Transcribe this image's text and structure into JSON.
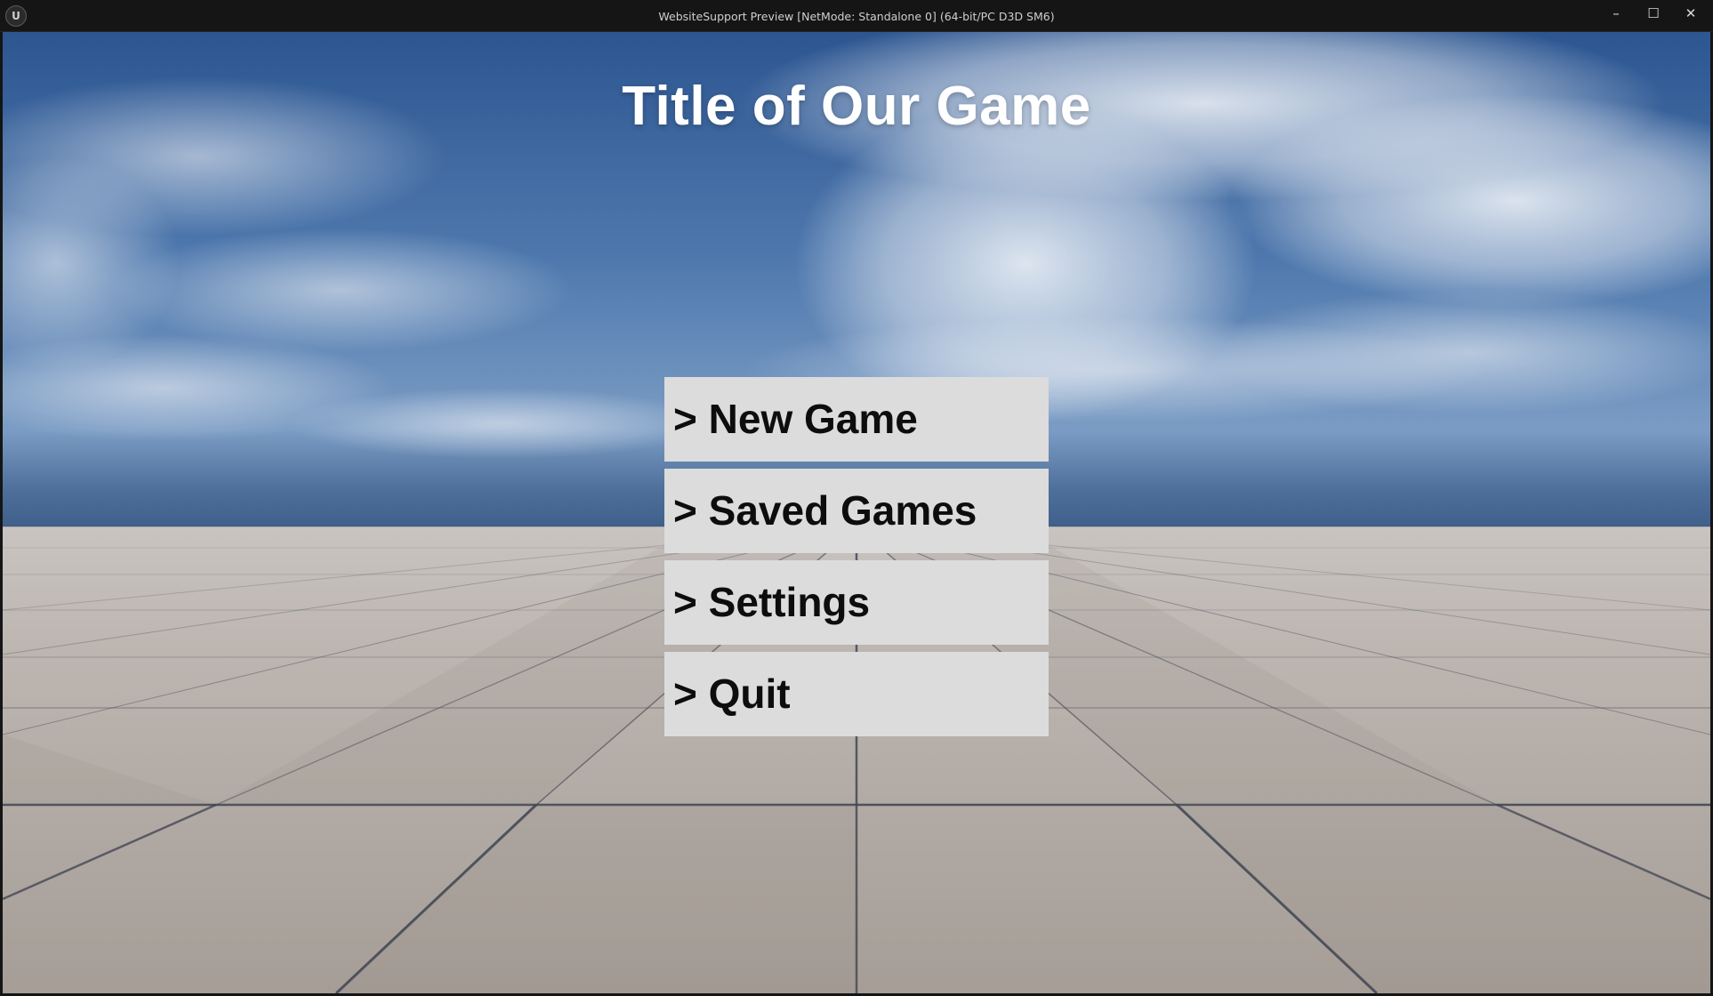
{
  "window": {
    "title": "WebsiteSupport Preview [NetMode: Standalone 0]  (64-bit/PC D3D SM6)",
    "icon": "unreal-engine-icon",
    "controls": {
      "minimize": "–",
      "maximize": "☐",
      "close": "✕"
    }
  },
  "game": {
    "title": "Title of Our Game"
  },
  "menu": {
    "items": [
      {
        "label": "> New Game"
      },
      {
        "label": "> Saved Games"
      },
      {
        "label": "> Settings"
      },
      {
        "label": "> Quit"
      }
    ]
  },
  "colors": {
    "sky_top": "#2d5691",
    "sky_horizon": "#7b9cc4",
    "floor": "#b3aba4",
    "grid_line": "#3b4150",
    "button_bg": "#dcdcdc",
    "button_text": "#0d0d0d",
    "title_text": "#ffffff"
  }
}
